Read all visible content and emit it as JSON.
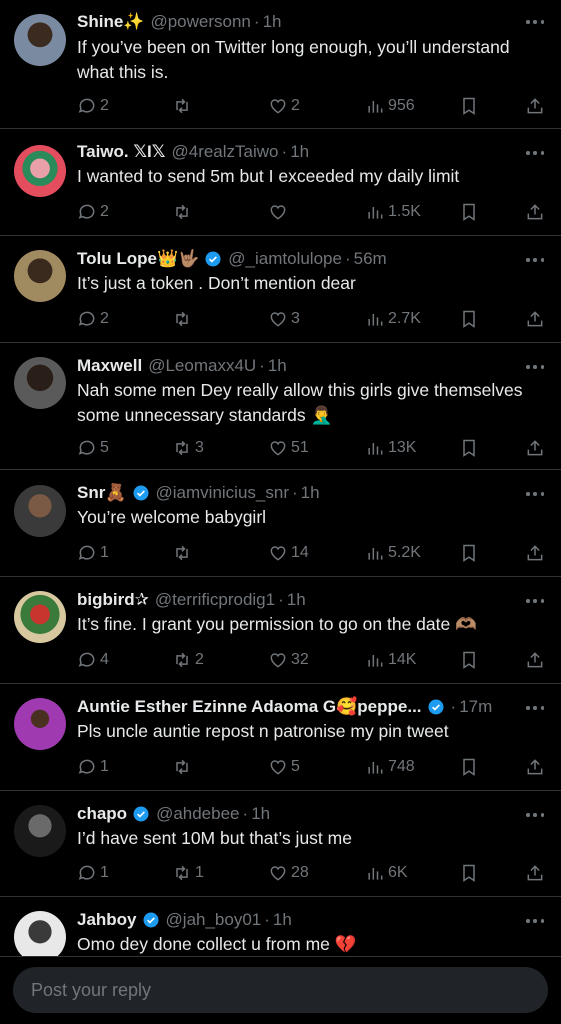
{
  "replies": [
    {
      "name": "Shine✨",
      "handle": "@powersonn",
      "time": "1h",
      "verified": false,
      "text": "If you’ve been on Twitter long enough, you’ll understand what this is.",
      "replies": "2",
      "reposts": "",
      "likes": "2",
      "views": "956"
    },
    {
      "name": "Taiwo. 𝕏I𝕏",
      "handle": "@4realzTaiwo",
      "time": "1h",
      "verified": false,
      "text": "I wanted to send 5m but I exceeded my daily limit",
      "replies": "2",
      "reposts": "",
      "likes": "",
      "views": "1.5K"
    },
    {
      "name": "Tolu Lope👑🤟🏽",
      "handle": "@_iamtolulope",
      "time": "56m",
      "verified": true,
      "text": "It’s just a token . Don’t mention dear",
      "replies": "2",
      "reposts": "",
      "likes": "3",
      "views": "2.7K"
    },
    {
      "name": "Maxwell",
      "handle": "@Leomaxx4U",
      "time": "1h",
      "verified": false,
      "text": "Nah some men Dey really allow this girls give themselves some unnecessary standards 🤦‍♂️",
      "replies": "5",
      "reposts": "3",
      "likes": "51",
      "views": "13K"
    },
    {
      "name": "Snr🧸",
      "handle": "@iamvinicius_snr",
      "time": "1h",
      "verified": true,
      "text": "You’re welcome babygirl",
      "replies": "1",
      "reposts": "",
      "likes": "14",
      "views": "5.2K"
    },
    {
      "name": "bigbird✰",
      "handle": "@terrificprodig1",
      "time": "1h",
      "verified": false,
      "text": "It’s fine. I grant you permission to go on the date 🫶🏽",
      "replies": "4",
      "reposts": "2",
      "likes": "32",
      "views": "14K"
    },
    {
      "name": "Auntie Esther Ezinne Adaoma G🥰peppe...",
      "handle": "",
      "time": "17m",
      "verified": true,
      "text": "Pls uncle auntie repost n patronise my pin tweet",
      "replies": "1",
      "reposts": "",
      "likes": "5",
      "views": "748"
    },
    {
      "name": "chapo",
      "handle": "@ahdebee",
      "time": "1h",
      "verified": true,
      "text": "I’d have sent 10M but that’s just me",
      "replies": "1",
      "reposts": "1",
      "likes": "28",
      "views": "6K"
    },
    {
      "name": "Jahboy",
      "handle": "@jah_boy01",
      "time": "1h",
      "verified": true,
      "text": "Omo dey done collect u from me 💔",
      "replies": "",
      "reposts": "",
      "likes": "",
      "views": ""
    }
  ],
  "composer": {
    "placeholder": "Post your reply"
  },
  "colors": {
    "background": "#000000",
    "muted": "#71767b",
    "verified": "#1d9bf0",
    "divider": "#2f3336"
  }
}
